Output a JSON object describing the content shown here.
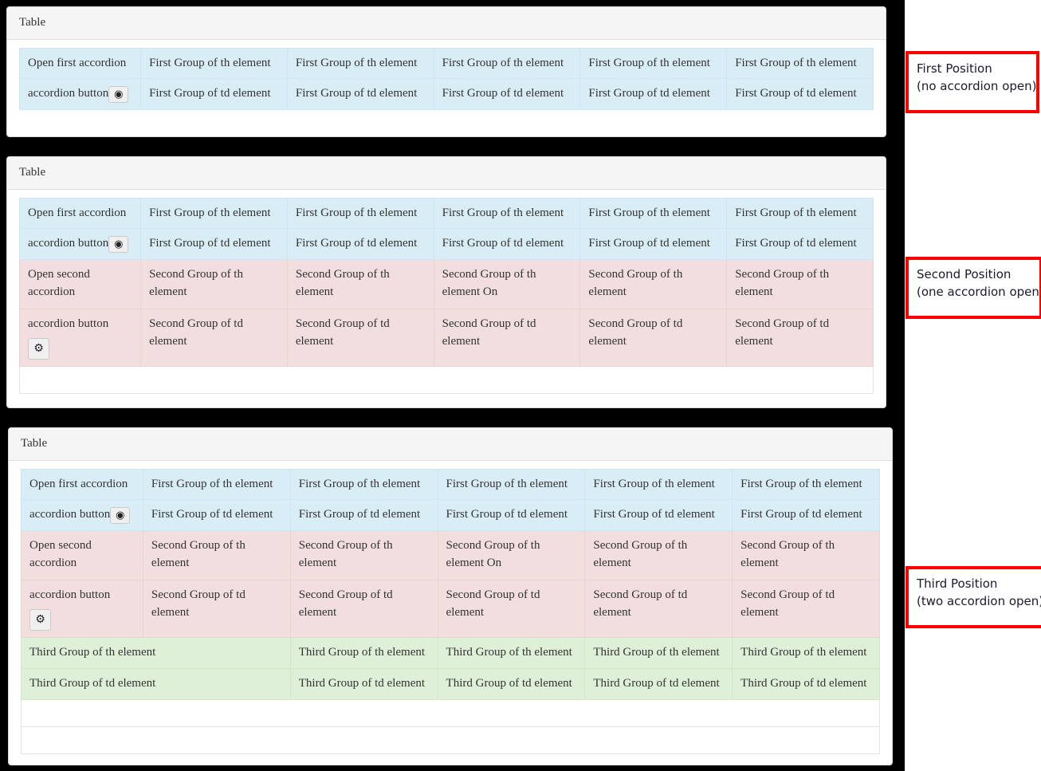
{
  "page": {
    "background_color": "#000000",
    "gutter_color": "#ffffff"
  },
  "colors": {
    "info_row": "#d9edf7",
    "danger_row": "#f2dede",
    "success_row": "#dff0d8",
    "panel_heading": "#f5f5f5",
    "panel_border": "#dddddd",
    "callout_border": "#ff0000",
    "text": "#333333"
  },
  "panels": [
    {
      "title": "Table",
      "state": "first-position",
      "table": {
        "groups": [
          {
            "name": "first-group",
            "variant": "info",
            "header_row": [
              "Open first accordion",
              "First Group of th element",
              "First Group of th element",
              "First Group of th element",
              "First Group of th element",
              "First Group of th element"
            ],
            "data_row": [
              "accordion button",
              "First Group of td element",
              "First Group of td element",
              "First Group of td element",
              "First Group of td element",
              "First Group of td element"
            ],
            "button": {
              "label": "accordion button",
              "icon": "eye-icon",
              "glyph": "◉"
            }
          }
        ],
        "empty_rows": 0
      }
    },
    {
      "title": "Table",
      "state": "second-position",
      "table": {
        "groups": [
          {
            "name": "first-group",
            "variant": "info",
            "header_row": [
              "Open first accordion",
              "First Group of th element",
              "First Group of th element",
              "First Group of th element",
              "First Group of th element",
              "First Group of th element"
            ],
            "data_row": [
              "accordion button",
              "First Group of td element",
              "First Group of td element",
              "First Group of td element",
              "First Group of td element",
              "First Group of td element"
            ],
            "button": {
              "label": "accordion button",
              "icon": "eye-icon",
              "glyph": "◉"
            }
          },
          {
            "name": "second-group",
            "variant": "danger",
            "header_row": [
              "Open second accordion",
              "Second Group of th element",
              "Second Group of th element",
              "Second Group of th element On",
              "Second Group of th element",
              "Second Group of th element"
            ],
            "data_row": [
              "accordion button",
              "Second Group of td element",
              "Second Group of td element",
              "Second Group of td element",
              "Second Group of td element",
              "Second Group of td element"
            ],
            "button": {
              "label": "accordion button",
              "icon": "gear-icon",
              "glyph": "⚙"
            }
          }
        ],
        "empty_rows": 1
      }
    },
    {
      "title": "Table",
      "state": "third-position",
      "table": {
        "groups": [
          {
            "name": "first-group",
            "variant": "info",
            "header_row": [
              "Open first accordion",
              "First Group of th element",
              "First Group of th element",
              "First Group of th element",
              "First Group of th element",
              "First Group of th element"
            ],
            "data_row": [
              "accordion button",
              "First Group of td element",
              "First Group of td element",
              "First Group of td element",
              "First Group of td element",
              "First Group of td element"
            ],
            "button": {
              "label": "accordion button",
              "icon": "eye-icon",
              "glyph": "◉"
            }
          },
          {
            "name": "second-group",
            "variant": "danger",
            "header_row": [
              "Open second accordion",
              "Second Group of th element",
              "Second Group of th element",
              "Second Group of th element On",
              "Second Group of th element",
              "Second Group of th element"
            ],
            "data_row": [
              "accordion button",
              "Second Group of td element",
              "Second Group of td element",
              "Second Group of td element",
              "Second Group of td element",
              "Second Group of td element"
            ],
            "button": {
              "label": "accordion button",
              "icon": "gear-icon",
              "glyph": "⚙"
            }
          },
          {
            "name": "third-group",
            "variant": "success",
            "header_row": [
              "Third Group of th element",
              "Third Group of th element",
              "Third Group of th element",
              "Third Group of th element",
              "Third Group of th element"
            ],
            "data_row": [
              "Third Group of td element",
              "Third Group of td element",
              "Third Group of td element",
              "Third Group of td element",
              "Third Group of td element"
            ],
            "button": null
          }
        ],
        "empty_rows": 2
      }
    }
  ],
  "callouts": [
    {
      "line1": "First Position",
      "line2": "(no accordion open)"
    },
    {
      "line1": "Second Position",
      "line2": "(one accordion open)"
    },
    {
      "line1": "Third Position",
      "line2": "(two accordion open)"
    }
  ]
}
